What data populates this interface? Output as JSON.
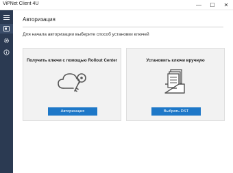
{
  "window": {
    "title": "ViPNet Client 4U",
    "controls": {
      "minimize": "—",
      "maximize": "☐",
      "close": "✕"
    }
  },
  "sidebar": {
    "items": [
      {
        "icon": "menu-icon",
        "active": false
      },
      {
        "icon": "key-card-icon",
        "active": true
      },
      {
        "icon": "gear-icon",
        "active": false
      },
      {
        "icon": "info-icon",
        "active": false
      }
    ]
  },
  "main": {
    "title": "Авторизация",
    "subtitle": "Для начала авторизации выберите способ установки ключей",
    "cards": [
      {
        "title": "Получить ключи с помощью Rollout Center",
        "illustration": "cloud-key-icon",
        "button": "Авторизация"
      },
      {
        "title": "Установить ключи вручную",
        "illustration": "file-tray-icon",
        "button": "Выбрать DST"
      }
    ]
  },
  "colors": {
    "sidebar": "#2b3a52",
    "accent": "#1e78c8",
    "card": "#f2f2f2"
  }
}
